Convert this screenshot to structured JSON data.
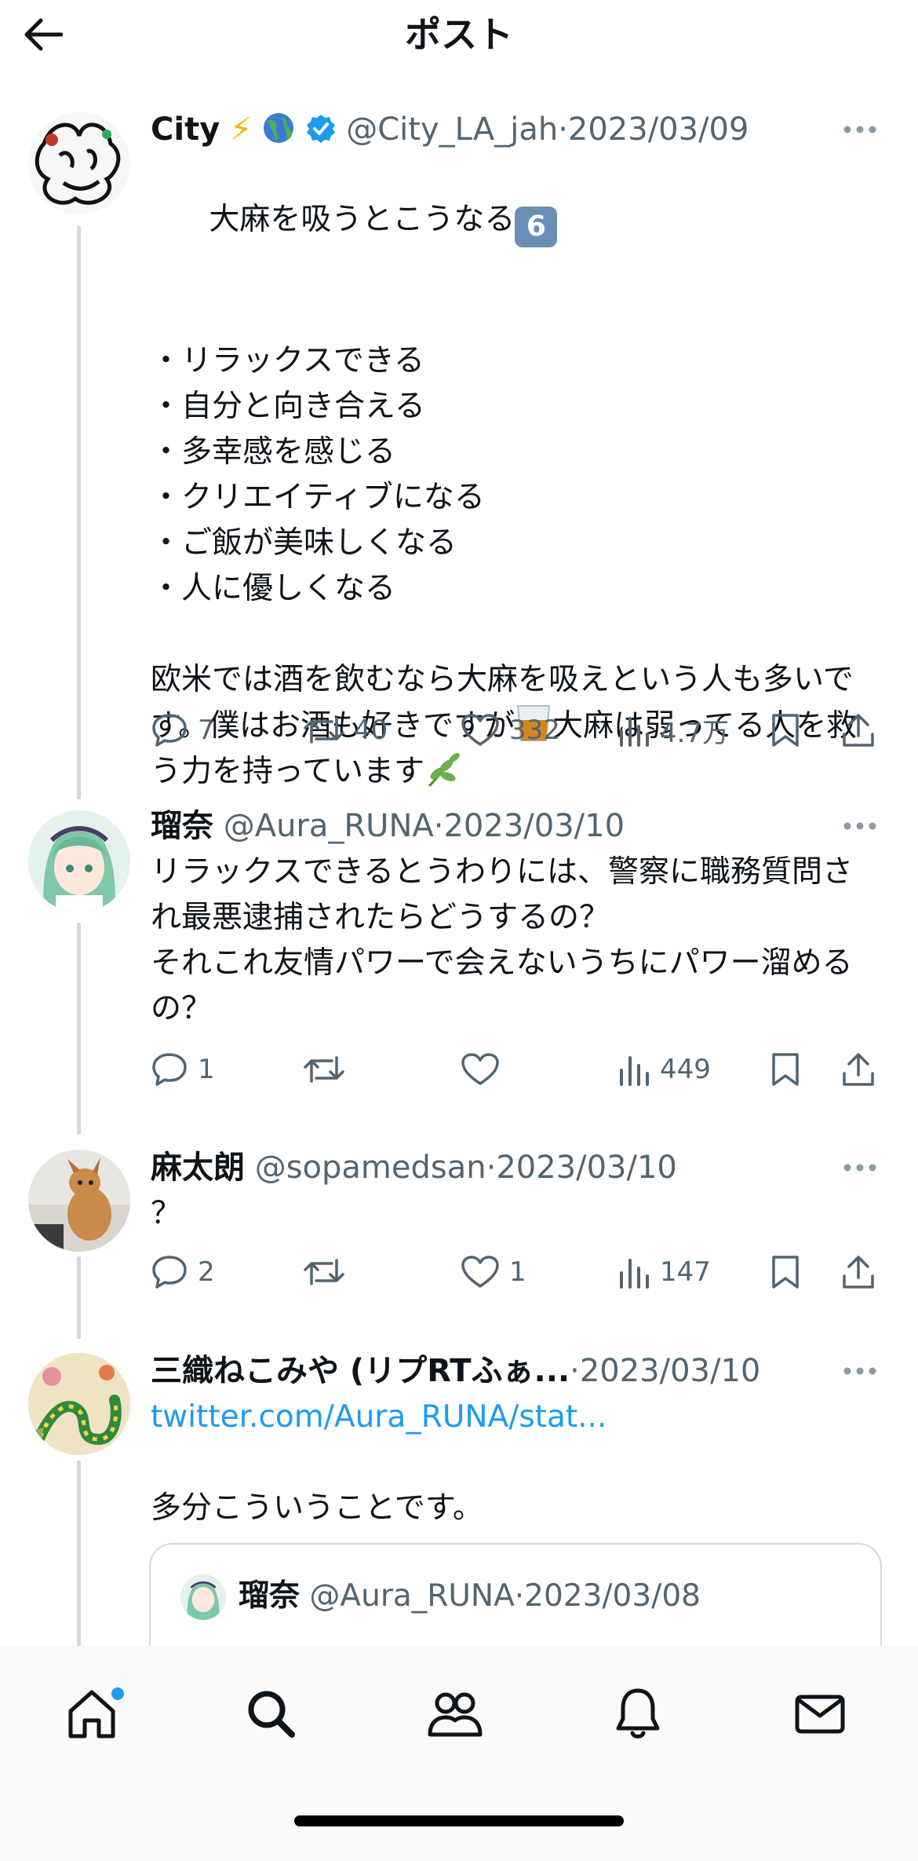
{
  "header": {
    "title": "ポスト"
  },
  "posts": [
    {
      "name": "City",
      "handle": "@City_LA_jah",
      "sep": "·",
      "date": "2023/03/09",
      "body_line1": "大麻を吸うとこうなる",
      "badge": "6",
      "list": "・リラックスできる\n・自分と向き合える\n・多幸感を感じる\n・クリエイティブになる\n・ご飯が美味しくなる\n・人に優しくなる",
      "para1": "欧米では酒を飲むなら大麻を吸えという人も多いです。僕はお酒も好きですが",
      "para2": "大麻は弱ってる人を救う力を持っています",
      "replies": "7",
      "reposts": "40",
      "likes": "332",
      "views": "4.7万"
    },
    {
      "name": "瑠奈",
      "handle": "@Aura_RUNA",
      "sep": "·",
      "date": "2023/03/10",
      "body": "リラックスできるとうわりには、警察に職務質問され最悪逮捕されたらどうするの？\nそれこれ友情パワーで会えないうちにパワー溜めるの？",
      "replies": "1",
      "reposts": "",
      "likes": "",
      "views": "449"
    },
    {
      "name": "麻太朗",
      "handle": "@sopamedsan",
      "sep": "·",
      "date": "2023/03/10",
      "body": "？",
      "replies": "2",
      "reposts": "",
      "likes": "1",
      "views": "147"
    },
    {
      "name": "三織ねこみや (リプRTふぁ...",
      "sep": "·",
      "date": "2023/03/10",
      "link": "twitter.com/Aura_RUNA/stat...",
      "body": "多分こういうことです。",
      "quote": {
        "name": "瑠奈",
        "handle": "@Aura_RUNA",
        "sep": "·",
        "date": "2023/03/08"
      }
    }
  ],
  "colors": {
    "accent": "#1d9bf0",
    "secondary_text": "#536471",
    "thread_line": "#cfd9de",
    "notification_dot": "#1d9bf0"
  },
  "nav": {
    "tabs": [
      "home-icon",
      "search-icon",
      "communities-icon",
      "notifications-icon",
      "messages-icon"
    ]
  }
}
